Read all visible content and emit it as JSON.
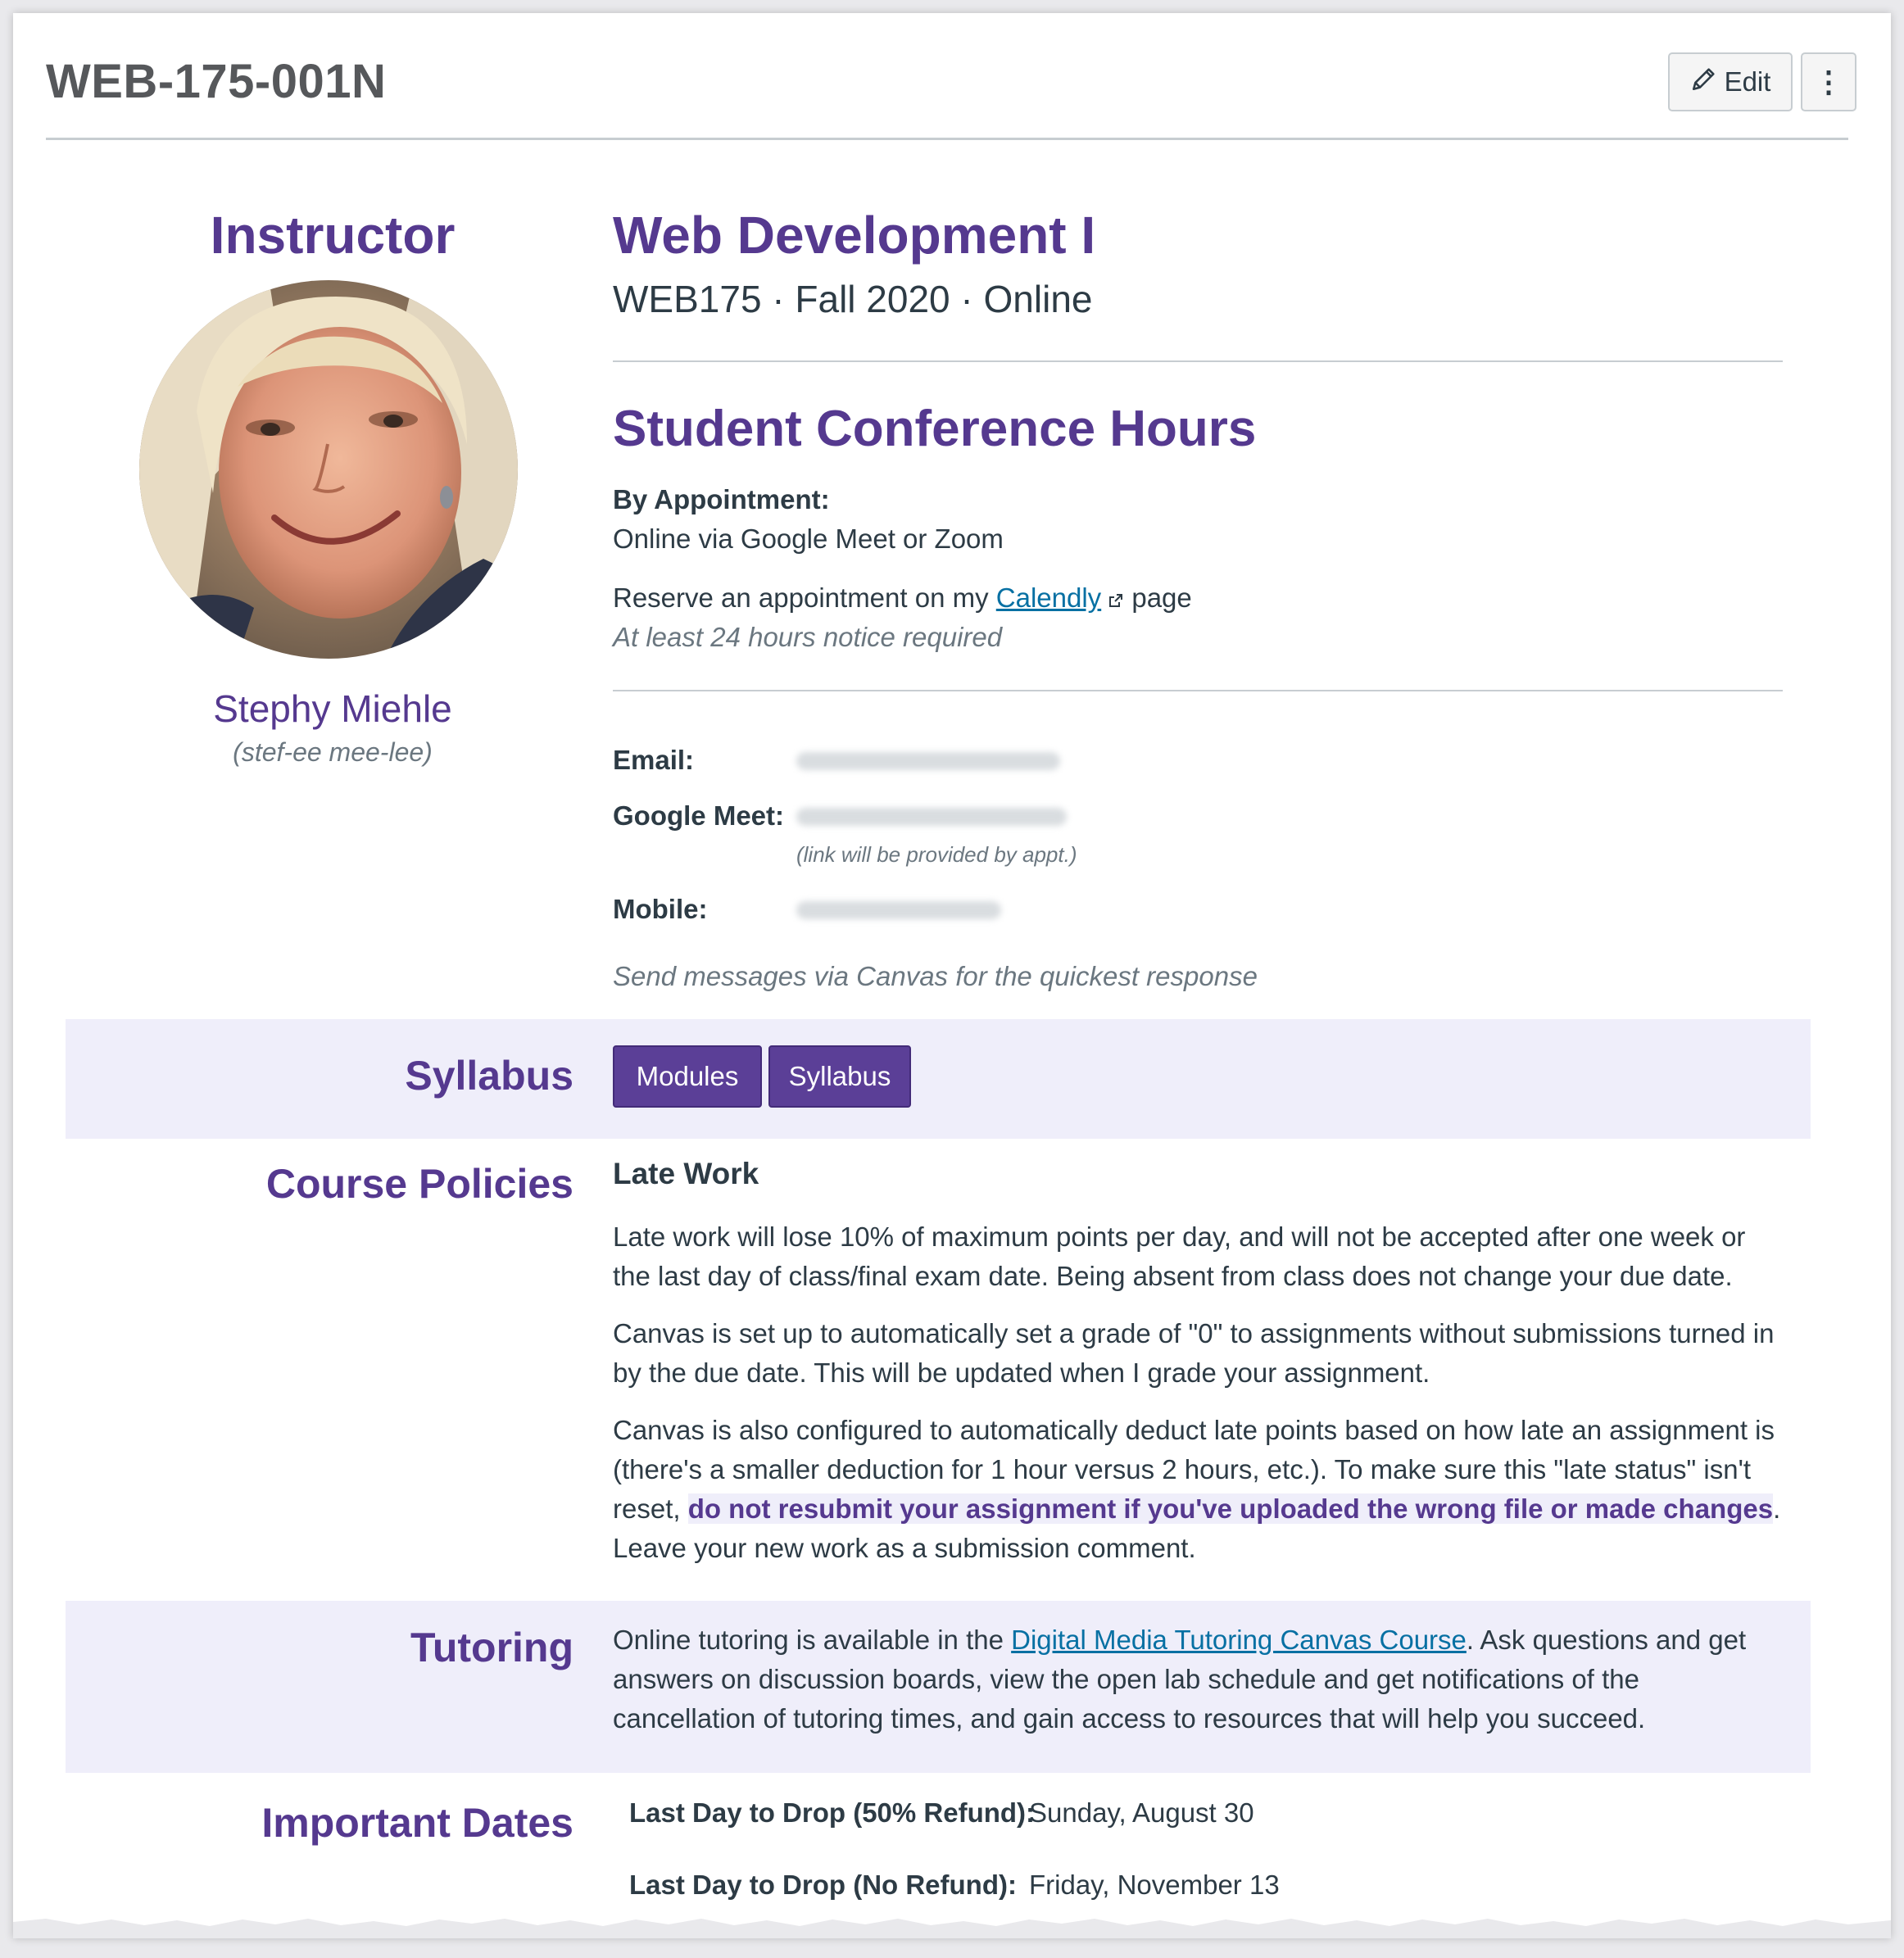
{
  "header": {
    "course_code": "WEB-175-001N",
    "edit_label": "Edit",
    "more_label": "⋮"
  },
  "instructor": {
    "heading": "Instructor",
    "name": "Stephy Miehle",
    "pronunciation": "(stef-ee mee-lee)"
  },
  "course": {
    "title": "Web Development I",
    "subtitle": "WEB175 · Fall 2020 · Online"
  },
  "conference": {
    "title": "Student Conference Hours",
    "by_appointment": "By Appointment:",
    "online_via": "Online via Google Meet or Zoom",
    "reserve_before": "Reserve an appointment on my ",
    "calendly_link": "Calendly",
    "reserve_after": " page",
    "notice": "At least 24 hours notice required"
  },
  "contact": {
    "email_label": "Email:",
    "meet_label": "Google Meet:",
    "meet_note": "(link will be provided by appt.)",
    "mobile_label": "Mobile:",
    "message_note": "Send messages via Canvas for the quickest response"
  },
  "syllabus": {
    "label": "Syllabus",
    "modules_button": "Modules",
    "syllabus_button": "Syllabus"
  },
  "policies": {
    "label": "Course Policies",
    "late_work_heading": "Late Work",
    "p1": "Late work will lose 10% of maximum points per day, and will not be accepted after one week or the last day of class/final exam date. Being absent from class does not change your due date.",
    "p2": "Canvas is set up to automatically set a grade of \"0\" to assignments without submissions turned in by the due date. This will be updated when I grade your assignment.",
    "p3_before": "Canvas is also configured to automatically deduct late points based on how late an assignment is (there's a smaller deduction for 1 hour versus 2 hours, etc.). To make sure this \"late status\" isn't reset, ",
    "p3_highlight": "do not resubmit your assignment if you've uploaded the wrong file or made changes",
    "p3_after": ". Leave your new work as a submission comment."
  },
  "tutoring": {
    "label": "Tutoring",
    "text_before": "Online tutoring is available in the ",
    "link": "Digital Media Tutoring Canvas Course",
    "text_after": ". Ask questions and get answers on discussion boards, view the open lab schedule and get notifications of the cancellation of tutoring times, and gain access to resources that will help you succeed."
  },
  "dates": {
    "label": "Important Dates",
    "rows": [
      {
        "label": "Last Day to Drop (50% Refund):",
        "value": "Sunday, August 30"
      },
      {
        "label": "Last Day to Drop (No Refund):",
        "value": "Friday, November 13"
      }
    ]
  }
}
